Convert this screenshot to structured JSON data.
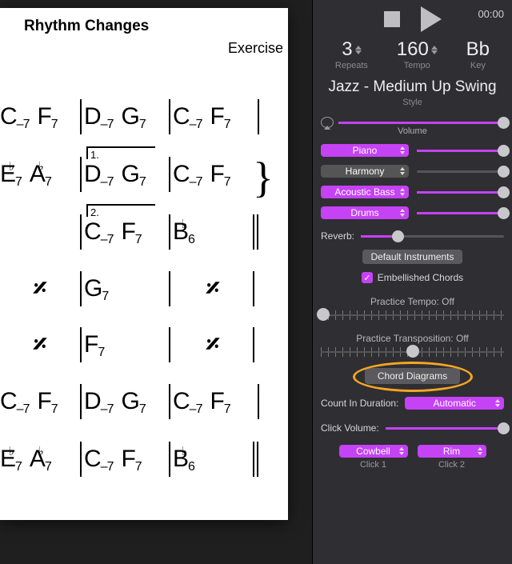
{
  "chart": {
    "title": "Rhythm Changes",
    "subtitle": "Exercise",
    "ending1": "1.",
    "ending2": "2.",
    "rows": [
      [
        [
          "C–7",
          "F7"
        ],
        [
          "D–7",
          "G7"
        ],
        [
          "C–7",
          "F7"
        ]
      ],
      [
        [
          "E♭7",
          "A♭7"
        ],
        [
          "D–7",
          "G7"
        ],
        [
          "C–7",
          "F7"
        ]
      ],
      [
        [
          ""
        ],
        [
          "C–7",
          "F7"
        ],
        [
          "B♭6"
        ]
      ],
      [
        [
          "𝄎"
        ],
        [
          "G7"
        ],
        [
          "𝄎"
        ]
      ],
      [
        [
          "𝄎"
        ],
        [
          "F7"
        ],
        [
          "𝄎"
        ]
      ],
      [
        [
          "C–7",
          "F7"
        ],
        [
          "D–7",
          "G7"
        ],
        [
          "C–7",
          "F7"
        ]
      ],
      [
        [
          "E♭7",
          "A♭7"
        ],
        [
          "C–7",
          "F7"
        ],
        [
          "B♭6"
        ]
      ]
    ]
  },
  "transport": {
    "time": "00:00",
    "repeats": {
      "value": "3",
      "label": "Repeats"
    },
    "tempo": {
      "value": "160",
      "label": "Tempo"
    },
    "key": {
      "value": "Bb",
      "label": "Key"
    }
  },
  "style": {
    "name": "Jazz - Medium Up Swing",
    "label": "Style"
  },
  "volume_label": "Volume",
  "instruments": {
    "piano": "Piano",
    "harmony": "Harmony",
    "bass": "Acoustic Bass",
    "drums": "Drums"
  },
  "reverb_label": "Reverb:",
  "default_instruments": "Default Instruments",
  "embellished": "Embellished Chords",
  "practice_tempo": "Practice Tempo: Off",
  "practice_transpose": "Practice Transposition: Off",
  "chord_diagrams": "Chord Diagrams",
  "count_in": {
    "label": "Count In Duration:",
    "value": "Automatic"
  },
  "click_volume": "Click Volume:",
  "click1": {
    "value": "Cowbell",
    "label": "Click 1"
  },
  "click2": {
    "value": "Rim",
    "label": "Click 2"
  }
}
